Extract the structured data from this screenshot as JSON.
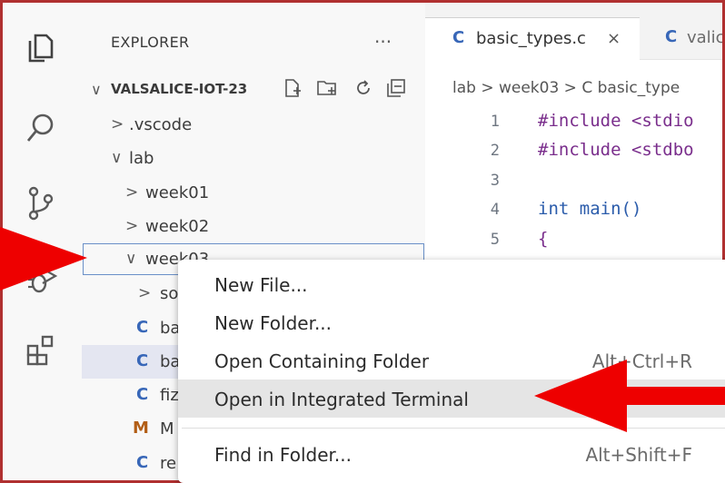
{
  "sidebar": {
    "title": "EXPLORER",
    "more": "···",
    "project": "VALSALICE-IOT-23",
    "tree": [
      {
        "label": ".vscode",
        "chevron": ">",
        "badge": ""
      },
      {
        "label": "lab",
        "chevron": "∨",
        "badge": ""
      },
      {
        "label": "week01",
        "chevron": ">",
        "badge": ""
      },
      {
        "label": "week02",
        "chevron": ">",
        "badge": ""
      },
      {
        "label": "week03",
        "chevron": "∨",
        "badge": ""
      },
      {
        "label": "so",
        "chevron": ">",
        "badge": ""
      },
      {
        "label": "ba",
        "chevron": "",
        "badge": "C"
      },
      {
        "label": "ba",
        "chevron": "",
        "badge": "C"
      },
      {
        "label": "fiz",
        "chevron": "",
        "badge": "C"
      },
      {
        "label": "M",
        "chevron": "",
        "badge": "M"
      },
      {
        "label": "re",
        "chevron": "",
        "badge": "C"
      }
    ]
  },
  "editor": {
    "tabs": [
      {
        "badge": "C",
        "label": "basic_types.c",
        "close": "×"
      },
      {
        "badge": "C",
        "label": "valic"
      }
    ],
    "breadcrumb": "lab  >  week03  >  C  basic_type",
    "lines": [
      {
        "num": "1",
        "text": "#include <stdio",
        "kind": "directive"
      },
      {
        "num": "2",
        "text": "#include <stdbo",
        "kind": "directive"
      },
      {
        "num": "3",
        "text": "",
        "kind": "plain"
      },
      {
        "num": "4",
        "text": "int main()",
        "kind": "keyword"
      },
      {
        "num": "5",
        "text": "{",
        "kind": "directive"
      }
    ]
  },
  "menu": {
    "items": [
      {
        "label": "New File...",
        "shortcut": ""
      },
      {
        "label": "New Folder...",
        "shortcut": ""
      },
      {
        "label": "Open Containing Folder",
        "shortcut": "Alt+Ctrl+R"
      },
      {
        "label": "Open in Integrated Terminal",
        "shortcut": ""
      },
      {
        "label": "Find in Folder...",
        "shortcut": "Alt+Shift+F"
      }
    ]
  },
  "colors": {
    "frame_border": "#b03030",
    "arrow": "#ee0000",
    "c_badge": "#3867b8",
    "m_badge": "#b25e16",
    "highlight": "#e5e5e5"
  },
  "icons": [
    "files-icon",
    "search-icon",
    "source-control-icon",
    "debug-icon",
    "extensions-icon",
    "new-file-icon",
    "new-folder-icon",
    "refresh-icon",
    "collapse-all-icon",
    "close-icon",
    "arrow-icon"
  ]
}
